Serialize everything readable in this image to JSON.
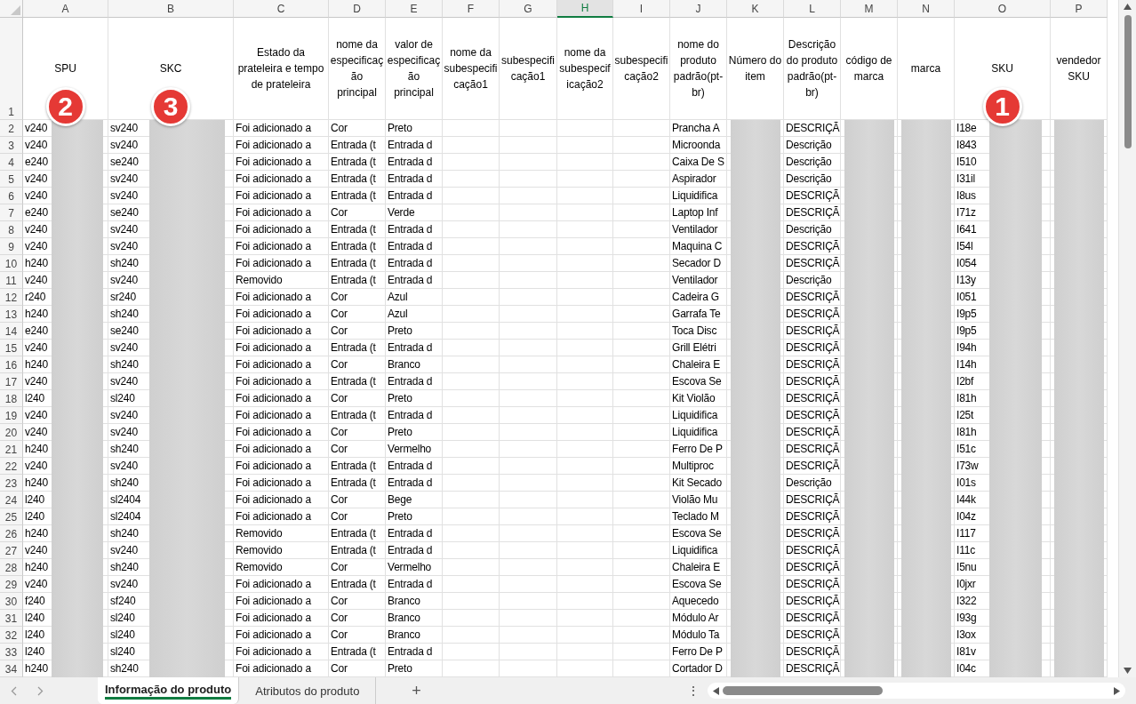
{
  "columns": [
    {
      "letter": "A",
      "header": "SPU",
      "selected": false,
      "redacted": true,
      "marker": "2"
    },
    {
      "letter": "B",
      "header": "SKC",
      "selected": false,
      "redacted": true,
      "marker": "3"
    },
    {
      "letter": "C",
      "header": "Estado da prateleira e tempo de prateleira",
      "selected": false,
      "redacted": false
    },
    {
      "letter": "D",
      "header": "nome da especificação principal",
      "selected": false,
      "redacted": false
    },
    {
      "letter": "E",
      "header": "valor de especificação principal",
      "selected": false,
      "redacted": false
    },
    {
      "letter": "F",
      "header": "nome da subespecificação1",
      "selected": false,
      "redacted": false
    },
    {
      "letter": "G",
      "header": "subespecificação1",
      "selected": false,
      "redacted": false
    },
    {
      "letter": "H",
      "header": "nome da subespecificação2",
      "selected": true,
      "redacted": false
    },
    {
      "letter": "I",
      "header": "subespecificação2",
      "selected": false,
      "redacted": false
    },
    {
      "letter": "J",
      "header": "nome do produto padrão(pt-br)",
      "selected": false,
      "redacted": false
    },
    {
      "letter": "K",
      "header": "Número do item",
      "selected": false,
      "redacted": true
    },
    {
      "letter": "L",
      "header": "Descrição do produto padrão(pt-br)",
      "selected": false,
      "redacted": false
    },
    {
      "letter": "M",
      "header": "código de marca",
      "selected": false,
      "redacted": true
    },
    {
      "letter": "N",
      "header": "marca",
      "selected": false,
      "redacted": true
    },
    {
      "letter": "O",
      "header": "SKU",
      "selected": false,
      "redacted": true,
      "marker": "1"
    },
    {
      "letter": "P",
      "header": "vendedor SKU",
      "selected": false,
      "redacted": true
    }
  ],
  "header_row_number": "1",
  "rows": [
    {
      "number": "2",
      "A": "v240",
      "B": "sv240",
      "C": "Foi adicionado a",
      "D": "Cor",
      "E": "Preto",
      "J": "Prancha A",
      "L": "DESCRIÇÃ",
      "O": "I18e"
    },
    {
      "number": "3",
      "A": "v240",
      "B": "sv240",
      "C": "Foi adicionado a",
      "D": "Entrada (t",
      "E": "Entrada d",
      "J": "Microonda",
      "L": "Descrição",
      "O": "I843"
    },
    {
      "number": "4",
      "A": "e240",
      "B": "se240",
      "C": "Foi adicionado a",
      "D": "Entrada (t",
      "E": "Entrada d",
      "J": "Caixa De S",
      "L": "Descrição",
      "O": "I510"
    },
    {
      "number": "5",
      "A": "v240",
      "B": "sv240",
      "C": "Foi adicionado a",
      "D": "Entrada (t",
      "E": "Entrada d",
      "J": "Aspirador",
      "L": "Descrição",
      "O": "I31il"
    },
    {
      "number": "6",
      "A": "v240",
      "B": "sv240",
      "C": "Foi adicionado a",
      "D": "Entrada (t",
      "E": "Entrada d",
      "J": "Liquidifica",
      "L": "DESCRIÇÃ",
      "O": "I8us"
    },
    {
      "number": "7",
      "A": "e240",
      "B": "se240",
      "C": "Foi adicionado a",
      "D": "Cor",
      "E": "Verde",
      "J": "Laptop Inf",
      "L": "DESCRIÇÃ",
      "O": "I71z"
    },
    {
      "number": "8",
      "A": "v240",
      "B": "sv240",
      "C": "Foi adicionado a",
      "D": "Entrada (t",
      "E": "Entrada d",
      "J": "Ventilador",
      "L": "Descrição",
      "O": "I641"
    },
    {
      "number": "9",
      "A": "v240",
      "B": "sv240",
      "C": "Foi adicionado a",
      "D": "Entrada (t",
      "E": "Entrada d",
      "J": "Maquina C",
      "L": "DESCRIÇÃ",
      "O": "I54l"
    },
    {
      "number": "10",
      "A": "h240",
      "B": "sh240",
      "C": "Foi adicionado a",
      "D": "Entrada (t",
      "E": "Entrada d",
      "J": "Secador D",
      "L": "DESCRIÇÃ",
      "O": "I054"
    },
    {
      "number": "11",
      "A": "v240",
      "B": "sv240",
      "C": "Removido",
      "D": "Entrada (t",
      "E": "Entrada d",
      "J": "Ventilador",
      "L": "Descrição",
      "O": "I13y"
    },
    {
      "number": "12",
      "A": "r240",
      "B": "sr240",
      "C": "Foi adicionado a",
      "D": "Cor",
      "E": "Azul",
      "J": "Cadeira G",
      "L": "DESCRIÇÃ",
      "O": "I051"
    },
    {
      "number": "13",
      "A": "h240",
      "B": "sh240",
      "C": "Foi adicionado a",
      "D": "Cor",
      "E": "Azul",
      "J": "Garrafa Te",
      "L": "DESCRIÇÃ",
      "O": "I9p5"
    },
    {
      "number": "14",
      "A": "e240",
      "B": "se240",
      "C": "Foi adicionado a",
      "D": "Cor",
      "E": "Preto",
      "J": "Toca Disc",
      "L": "DESCRIÇÃ",
      "O": "I9p5"
    },
    {
      "number": "15",
      "A": "v240",
      "B": "sv240",
      "C": "Foi adicionado a",
      "D": "Entrada (t",
      "E": "Entrada d",
      "J": "Grill Elétri",
      "L": "DESCRIÇÃ",
      "O": "I94h"
    },
    {
      "number": "16",
      "A": "h240",
      "B": "sh240",
      "C": "Foi adicionado a",
      "D": "Cor",
      "E": "Branco",
      "J": "Chaleira E",
      "L": "DESCRIÇÃ",
      "O": "I14h"
    },
    {
      "number": "17",
      "A": "v240",
      "B": "sv240",
      "C": "Foi adicionado a",
      "D": "Entrada (t",
      "E": "Entrada d",
      "J": "Escova Se",
      "L": "DESCRIÇÃ",
      "O": "I2bf"
    },
    {
      "number": "18",
      "A": "l240",
      "B": "sl240",
      "C": "Foi adicionado a",
      "D": "Cor",
      "E": "Preto",
      "J": "Kit Violão",
      "L": "DESCRIÇÃ",
      "O": "I81h"
    },
    {
      "number": "19",
      "A": "v240",
      "B": "sv240",
      "C": "Foi adicionado a",
      "D": "Entrada (t",
      "E": "Entrada d",
      "J": "Liquidifica",
      "L": "DESCRIÇÃ",
      "O": "I25t"
    },
    {
      "number": "20",
      "A": "v240",
      "B": "sv240",
      "C": "Foi adicionado a",
      "D": "Cor",
      "E": "Preto",
      "J": "Liquidifica",
      "L": "DESCRIÇÃ",
      "O": "I81h"
    },
    {
      "number": "21",
      "A": "h240",
      "B": "sh240",
      "C": "Foi adicionado a",
      "D": "Cor",
      "E": "Vermelho",
      "J": "Ferro De P",
      "L": "DESCRIÇÃ",
      "O": "I51c"
    },
    {
      "number": "22",
      "A": "v240",
      "B": "sv240",
      "C": "Foi adicionado a",
      "D": "Entrada (t",
      "E": "Entrada d",
      "J": "Multiproc",
      "L": "DESCRIÇÃ",
      "O": "I73w"
    },
    {
      "number": "23",
      "A": "h240",
      "B": "sh240",
      "C": "Foi adicionado a",
      "D": "Entrada (t",
      "E": "Entrada d",
      "J": "Kit Secado",
      "L": "Descrição",
      "O": "I01s"
    },
    {
      "number": "24",
      "A": "l240",
      "B": "sl2404",
      "C": "Foi adicionado a",
      "D": "Cor",
      "E": "Bege",
      "J": "Violão Mu",
      "L": "DESCRIÇÃ",
      "O": "I44k"
    },
    {
      "number": "25",
      "A": "l240",
      "B": "sl2404",
      "C": "Foi adicionado a",
      "D": "Cor",
      "E": "Preto",
      "J": "Teclado M",
      "L": "DESCRIÇÃ",
      "O": "I04z"
    },
    {
      "number": "26",
      "A": "h240",
      "B": "sh240",
      "C": "Removido",
      "D": "Entrada (t",
      "E": "Entrada d",
      "J": "Escova Se",
      "L": "DESCRIÇÃ",
      "O": "I117"
    },
    {
      "number": "27",
      "A": "v240",
      "B": "sv240",
      "C": "Removido",
      "D": "Entrada (t",
      "E": "Entrada d",
      "J": "Liquidifica",
      "L": "DESCRIÇÃ",
      "O": "I11c"
    },
    {
      "number": "28",
      "A": "h240",
      "B": "sh240",
      "C": "Removido",
      "D": "Cor",
      "E": "Vermelho",
      "J": "Chaleira E",
      "L": "DESCRIÇÃ",
      "O": "I5nu"
    },
    {
      "number": "29",
      "A": "v240",
      "B": "sv240",
      "C": "Foi adicionado a",
      "D": "Entrada (t",
      "E": "Entrada d",
      "J": "Escova Se",
      "L": "DESCRIÇÃ",
      "O": "I0jxr"
    },
    {
      "number": "30",
      "A": "f240",
      "B": "sf240",
      "C": "Foi adicionado a",
      "D": "Cor",
      "E": "Branco",
      "J": "Aquecedo",
      "L": "DESCRIÇÃ",
      "O": "I322"
    },
    {
      "number": "31",
      "A": "l240",
      "B": "sl240",
      "C": "Foi adicionado a",
      "D": "Cor",
      "E": "Branco",
      "J": "Módulo Ar",
      "L": "DESCRIÇÃ",
      "O": "I93g"
    },
    {
      "number": "32",
      "A": "l240",
      "B": "sl240",
      "C": "Foi adicionado a",
      "D": "Cor",
      "E": "Branco",
      "J": "Módulo Ta",
      "L": "DESCRIÇÃ",
      "O": "I3ox"
    },
    {
      "number": "33",
      "A": "l240",
      "B": "sl240",
      "C": "Foi adicionado a",
      "D": "Entrada (t",
      "E": "Entrada d",
      "J": "Ferro De P",
      "L": "DESCRIÇÃ",
      "O": "I81v"
    },
    {
      "number": "34",
      "A": "h240",
      "B": "sh240",
      "C": "Foi adicionado a",
      "D": "Cor",
      "E": "Preto",
      "J": "Cortador D",
      "L": "DESCRIÇÃ",
      "O": "I04c"
    }
  ],
  "sheet_tabs": [
    {
      "label": "Informação do produto",
      "selected": true
    },
    {
      "label": "Atributos do produto",
      "selected": false
    }
  ],
  "tab_bar": {
    "add": "+",
    "more": "⋮"
  }
}
